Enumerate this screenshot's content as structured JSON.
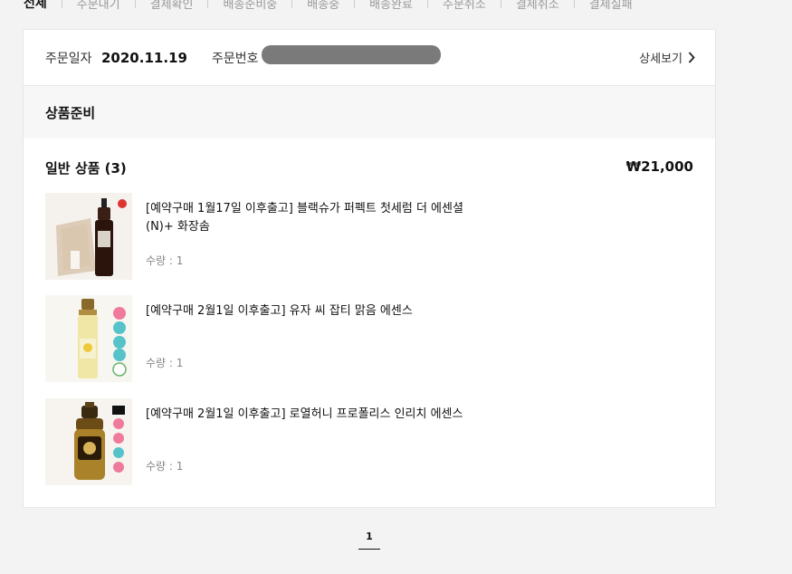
{
  "tabs": [
    "전체",
    "주문내기",
    "결제확인",
    "배송준비중",
    "배송중",
    "배송완료",
    "주문취소",
    "결제취소",
    "결제실패"
  ],
  "order": {
    "date_label": "주문일자",
    "date_value": "2020.11.19",
    "number_label": "주문번호",
    "detail_label": "상세보기"
  },
  "status": "상품준비",
  "group": {
    "title": "일반 상품 (3)",
    "total": "₩21,000"
  },
  "products": [
    {
      "name": "[예약구매 1월17일 이후출고] 블랙슈가 퍼펙트 첫세럼 더 에센셜(N)+ 화장솜",
      "qty": "수량 : 1"
    },
    {
      "name": "[예약구매 2월1일 이후출고] 유자 씨 잡티 맑음 에센스",
      "qty": "수량 : 1"
    },
    {
      "name": "[예약구매 2월1일 이후출고] 로열허니 프로폴리스 인리치 에센스",
      "qty": "수량 : 1"
    }
  ],
  "pagination": {
    "current": "1"
  },
  "colors": {
    "background": "#f3f3f3",
    "card": "#ffffff",
    "status_bg": "#f7f7f7",
    "mask": "#7a7a7a"
  }
}
